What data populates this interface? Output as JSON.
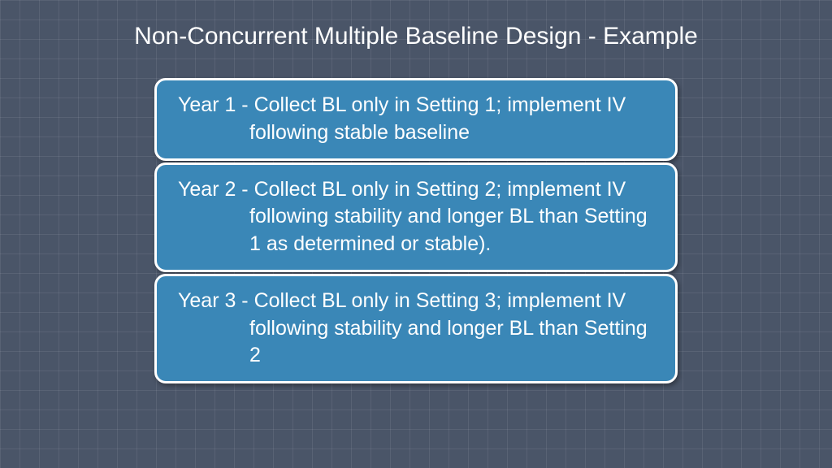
{
  "slide": {
    "title": "Non-Concurrent Multiple Baseline Design - Example",
    "boxes": [
      {
        "text": "Year 1 - Collect BL only in Setting 1; implement IV following stable baseline"
      },
      {
        "text": "Year 2 - Collect BL only in Setting 2; implement IV following stability and longer BL than Setting 1 as determined or stable)."
      },
      {
        "text": "Year 3 - Collect BL only in Setting 3; implement IV following stability and longer BL than Setting 2"
      }
    ],
    "colors": {
      "background": "#4a5568",
      "box_fill": "#3a87b7",
      "box_border": "#ffffff",
      "text": "#ffffff"
    }
  }
}
